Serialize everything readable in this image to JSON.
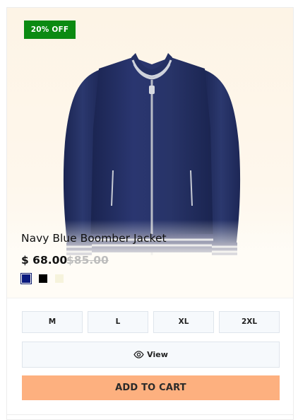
{
  "product": {
    "discount_badge": "20% OFF",
    "title": "Navy Blue Boomber Jacket",
    "price": "$ 68.00",
    "old_price": "$85.00",
    "image_icon": "navy-bomber-jacket-image"
  },
  "colors": [
    {
      "name": "navy",
      "hex": "#0a1a7e",
      "selected": true
    },
    {
      "name": "black",
      "hex": "#000000",
      "selected": false
    },
    {
      "name": "cream",
      "hex": "#f6f3dc",
      "selected": false
    }
  ],
  "sizes": [
    "M",
    "L",
    "XL",
    "2XL"
  ],
  "actions": {
    "view_label": "View",
    "view_icon": "eye-icon",
    "add_to_cart_label": "ADD TO CART"
  },
  "theme": {
    "badge_bg": "#0b8a12",
    "cart_bg": "#fdb07f",
    "hero_bg": "#fdf4e6"
  }
}
